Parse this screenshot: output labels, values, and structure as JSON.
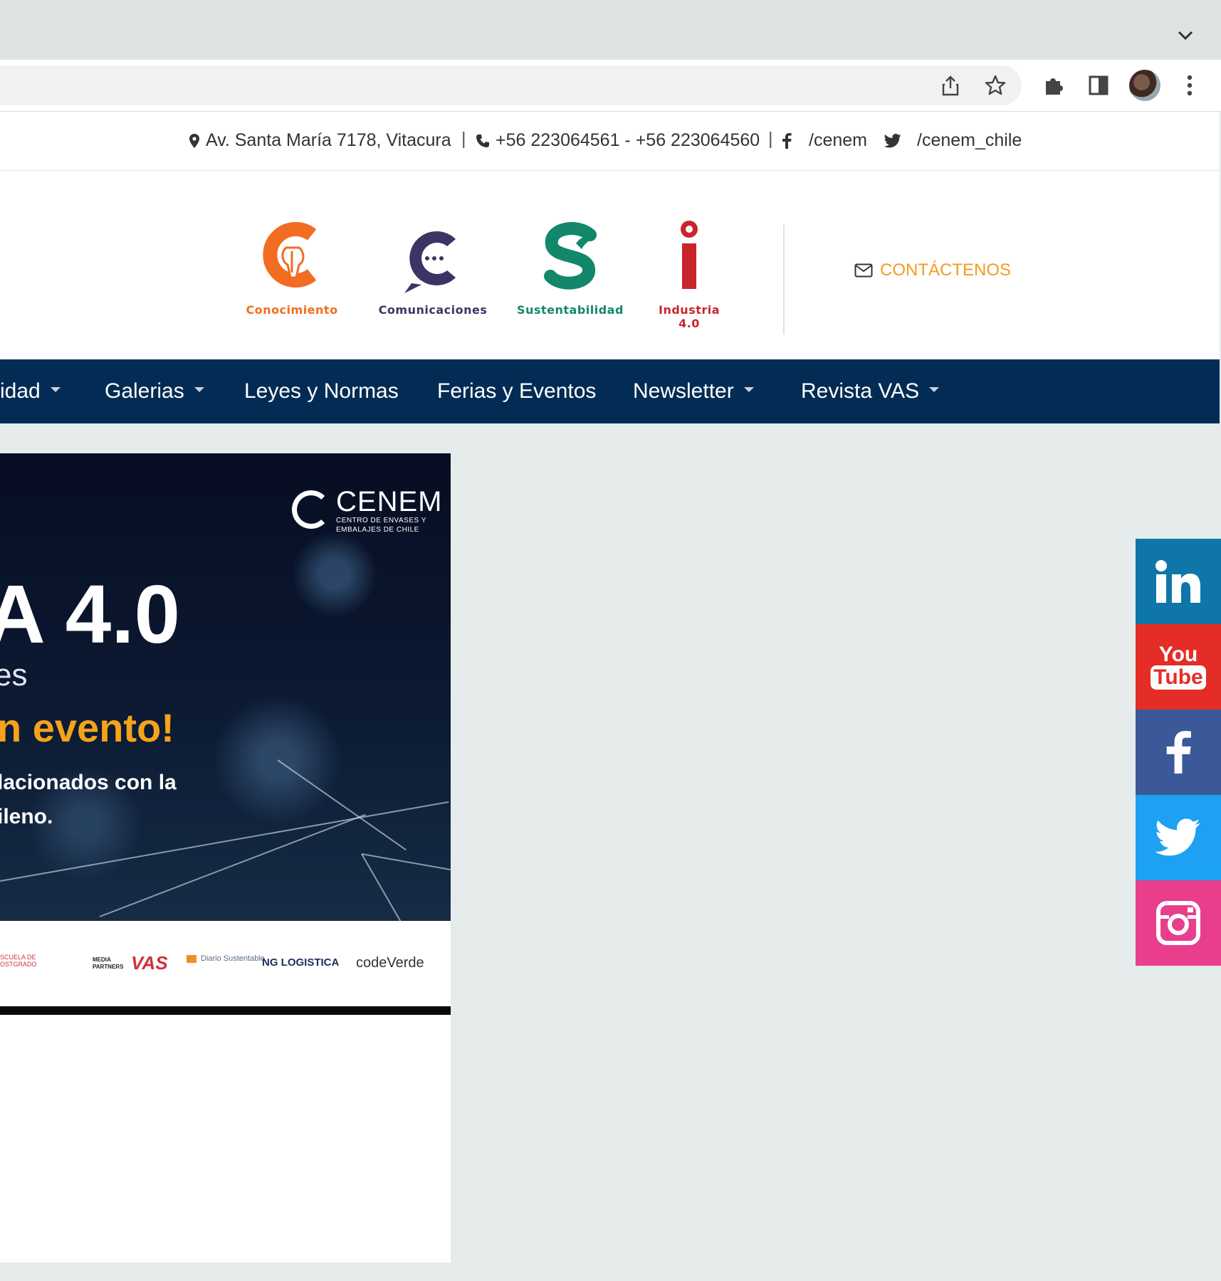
{
  "infobar": {
    "address": "Av. Santa María 7178, Vitacura",
    "separator": "|",
    "phones": "+56 223064561 - +56 223064560",
    "facebook": "/cenem",
    "twitter": "/cenem_chile"
  },
  "header": {
    "brands": [
      {
        "label": "Conocimiento",
        "letter": "C",
        "color": "#f26c22"
      },
      {
        "label": "Comunicaciones",
        "letter": "C",
        "color": "#3d3466"
      },
      {
        "label": "Sustentabilidad",
        "letter": "S",
        "color": "#12876c"
      },
      {
        "label": "Industria 4.0",
        "letter": "i",
        "color": "#c9252c"
      }
    ],
    "contact_label": "CONTÁCTENOS"
  },
  "nav": {
    "items": [
      {
        "label": "idad",
        "dropdown": true
      },
      {
        "label": "Galerias",
        "dropdown": true
      },
      {
        "label": "Leyes y Normas",
        "dropdown": false
      },
      {
        "label": "Ferias y Eventos",
        "dropdown": false
      },
      {
        "label": "Newsletter",
        "dropdown": true
      },
      {
        "label": "Revista VAS",
        "dropdown": true
      }
    ]
  },
  "banner": {
    "logo_name": "CENEM",
    "logo_sub": "CENTRO DE ENVASES Y EMBALAJES DE CHILE",
    "headline": "A 4.0",
    "subline": "es",
    "event": "n evento!",
    "desc_line1": "lacionados con la",
    "desc_line2": "ileno.",
    "sponsors": [
      "ESCUELA DE POSTGRADO",
      "MEDIA PARTNERS",
      "VAS",
      "Diario Sustentable",
      "NG LOGISTICA",
      "codeVerde"
    ]
  },
  "social": [
    {
      "name": "LinkedIn",
      "color": "#0e76a8"
    },
    {
      "name": "YouTube",
      "color": "#e52d27",
      "text_top": "You",
      "text_bottom": "Tube"
    },
    {
      "name": "Facebook",
      "color": "#3b5998"
    },
    {
      "name": "Twitter",
      "color": "#1da1f2"
    },
    {
      "name": "Instagram",
      "color": "#e83e8c"
    }
  ],
  "colors": {
    "nav_bg": "#032c54",
    "accent": "#f29b24"
  }
}
